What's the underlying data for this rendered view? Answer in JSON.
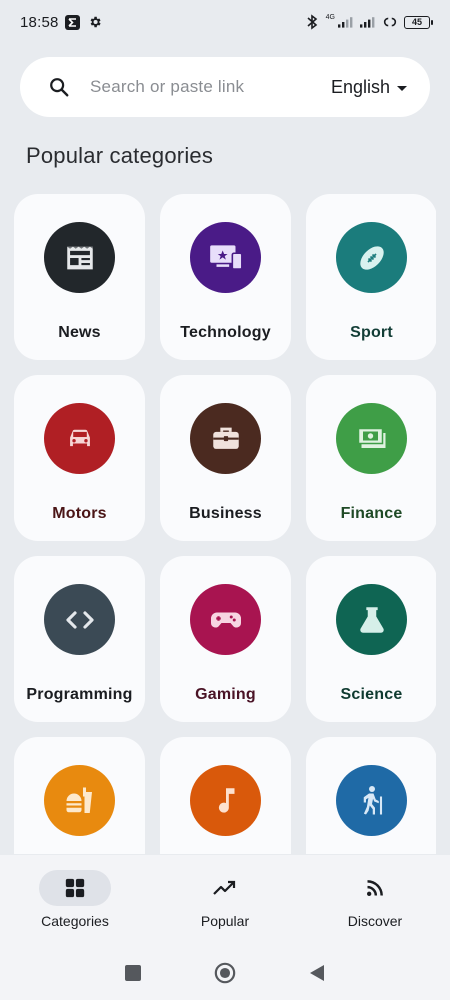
{
  "status_bar": {
    "time": "18:58",
    "network_type": "4G",
    "battery_level": "45"
  },
  "search": {
    "placeholder": "Search or paste link",
    "language": "English"
  },
  "section_title": "Popular categories",
  "categories": [
    {
      "label": "News",
      "icon": "newspaper-icon",
      "color": "#22272b",
      "label_color": "#1b1d21"
    },
    {
      "label": "Technology",
      "icon": "devices-icon",
      "color": "#4a1b87",
      "label_color": "#1b1d21"
    },
    {
      "label": "Sport",
      "icon": "football-icon",
      "color": "#1b7c7c",
      "label_color": "#123d36"
    },
    {
      "label": "Motors",
      "icon": "car-icon",
      "color": "#b01f24",
      "label_color": "#4a1516"
    },
    {
      "label": "Business",
      "icon": "briefcase-icon",
      "color": "#4b2a20",
      "label_color": "#1b1d21"
    },
    {
      "label": "Finance",
      "icon": "money-icon",
      "color": "#3f9e47",
      "label_color": "#1f4a26"
    },
    {
      "label": "Programming",
      "icon": "code-icon",
      "color": "#3b4a55",
      "label_color": "#1b1d21"
    },
    {
      "label": "Gaming",
      "icon": "gamepad-icon",
      "color": "#a81450",
      "label_color": "#4a1326"
    },
    {
      "label": "Science",
      "icon": "flask-icon",
      "color": "#0f6553",
      "label_color": "#0f3a30"
    },
    {
      "label": "",
      "icon": "fastfood-icon",
      "color": "#e88a0f",
      "label_color": "#1b1d21"
    },
    {
      "label": "",
      "icon": "music-note-icon",
      "color": "#d9590b",
      "label_color": "#1b1d21"
    },
    {
      "label": "",
      "icon": "hiking-icon",
      "color": "#1f6aa6",
      "label_color": "#1b1d21"
    }
  ],
  "bottom_nav": [
    {
      "label": "Categories",
      "icon": "grid-icon",
      "active": true
    },
    {
      "label": "Popular",
      "icon": "trending-up-icon",
      "active": false
    },
    {
      "label": "Discover",
      "icon": "rss-icon",
      "active": false
    }
  ],
  "system_nav": {
    "icons": [
      "recents-square-icon",
      "home-circle-icon",
      "back-triangle-icon"
    ]
  }
}
